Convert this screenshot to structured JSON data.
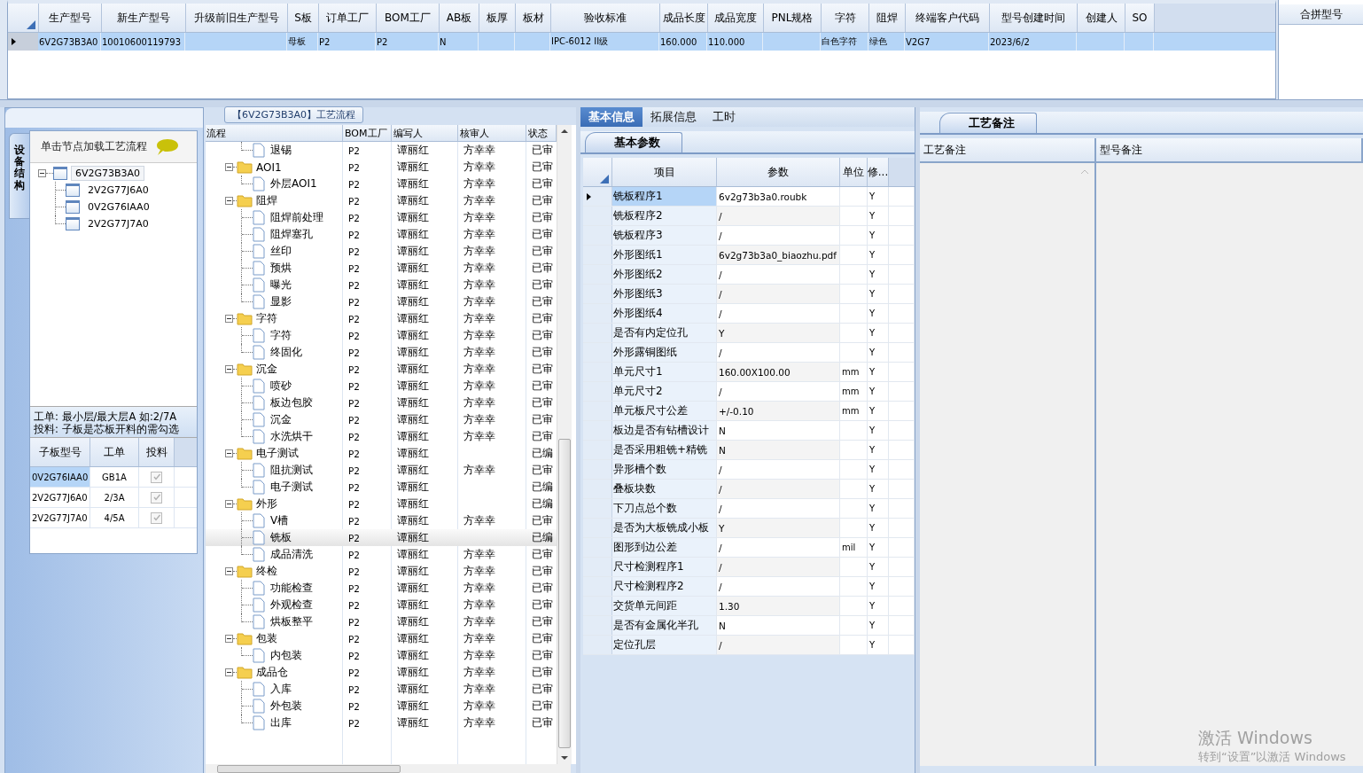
{
  "top_table": {
    "columns": [
      "生产型号",
      "新生产型号",
      "升级前旧生产型号",
      "S板",
      "订单工厂",
      "BOM工厂",
      "AB板",
      "板厚",
      "板材",
      "验收标准",
      "成品长度",
      "成品宽度",
      "PNL规格",
      "字符",
      "阻焊",
      "终端客户代码",
      "型号创建时间",
      "创建人",
      "SO"
    ],
    "rows": [
      {
        "selected": true,
        "cells": [
          "6V2G73B3A0",
          "10010600119793",
          null,
          "母板",
          "P2",
          "P2",
          "N",
          null,
          null,
          "IPC-6012 II级",
          "160.000",
          "110.000",
          null,
          "白色字符",
          "绿色",
          "V2G7",
          "2023/6/2",
          null,
          null
        ]
      }
    ]
  },
  "merge_panel": {
    "header": "合拼型号"
  },
  "structure_panel": {
    "side_tab": "设备结构",
    "hint": "单击节点加载工艺流程",
    "tree": [
      {
        "label": "6V2G73B3A0",
        "expanded": true,
        "selected": true,
        "children": [
          {
            "label": "2V2G77J6A0",
            "selected": false
          },
          {
            "label": "0V2G76IAA0",
            "selected": false
          },
          {
            "label": "2V2G77J7A0",
            "selected": false
          }
        ]
      }
    ],
    "note_lines": [
      "工单: 最小层/最大层A 如:2/7A",
      "投料: 子板是芯板开料的需勾选"
    ],
    "sub_boards": {
      "columns": [
        "子板型号",
        "工单",
        "投料"
      ],
      "rows": [
        {
          "model": "0V2G76IAA0",
          "order": "GB1A",
          "checked": true,
          "selected": true
        },
        {
          "model": "2V2G77J6A0",
          "order": "2/3A",
          "checked": true,
          "selected": false
        },
        {
          "model": "2V2G77J7A0",
          "order": "4/5A",
          "checked": true,
          "selected": false
        }
      ]
    }
  },
  "process_panel": {
    "title": "【6V2G73B3A0】工艺流程",
    "columns": [
      "流程",
      "BOM工厂",
      "编写人",
      "核审人",
      "状态"
    ],
    "rows": [
      {
        "kind": "step",
        "name": "退锡",
        "bom": "P2",
        "writer": "谭丽红",
        "reviewer": "方幸幸",
        "status": "已审",
        "selected": false
      },
      {
        "kind": "folder",
        "name": "AOI1",
        "bom": "P2",
        "writer": "谭丽红",
        "reviewer": "方幸幸",
        "status": "已审",
        "selected": false,
        "expanded": true,
        "children": [
          {
            "kind": "step",
            "name": "外层AOI1",
            "bom": "P2",
            "writer": "谭丽红",
            "reviewer": "方幸幸",
            "status": "已审",
            "selected": false
          }
        ]
      },
      {
        "kind": "folder",
        "name": "阻焊",
        "bom": "P2",
        "writer": "谭丽红",
        "reviewer": "方幸幸",
        "status": "已审",
        "selected": false,
        "expanded": true,
        "children": [
          {
            "kind": "step",
            "name": "阻焊前处理",
            "bom": "P2",
            "writer": "谭丽红",
            "reviewer": "方幸幸",
            "status": "已审",
            "selected": false
          },
          {
            "kind": "step",
            "name": "阻焊塞孔",
            "bom": "P2",
            "writer": "谭丽红",
            "reviewer": "方幸幸",
            "status": "已审",
            "selected": false
          },
          {
            "kind": "step",
            "name": "丝印",
            "bom": "P2",
            "writer": "谭丽红",
            "reviewer": "方幸幸",
            "status": "已审",
            "selected": false
          },
          {
            "kind": "step",
            "name": "预烘",
            "bom": "P2",
            "writer": "谭丽红",
            "reviewer": "方幸幸",
            "status": "已审",
            "selected": false
          },
          {
            "kind": "step",
            "name": "曝光",
            "bom": "P2",
            "writer": "谭丽红",
            "reviewer": "方幸幸",
            "status": "已审",
            "selected": false
          },
          {
            "kind": "step",
            "name": "显影",
            "bom": "P2",
            "writer": "谭丽红",
            "reviewer": "方幸幸",
            "status": "已审",
            "selected": false
          }
        ]
      },
      {
        "kind": "folder",
        "name": "字符",
        "bom": "P2",
        "writer": "谭丽红",
        "reviewer": "方幸幸",
        "status": "已审",
        "selected": false,
        "expanded": true,
        "children": [
          {
            "kind": "step",
            "name": "字符",
            "bom": "P2",
            "writer": "谭丽红",
            "reviewer": "方幸幸",
            "status": "已审",
            "selected": false
          },
          {
            "kind": "step",
            "name": "终固化",
            "bom": "P2",
            "writer": "谭丽红",
            "reviewer": "方幸幸",
            "status": "已审",
            "selected": false
          }
        ]
      },
      {
        "kind": "folder",
        "name": "沉金",
        "bom": "P2",
        "writer": "谭丽红",
        "reviewer": "方幸幸",
        "status": "已审",
        "selected": false,
        "expanded": true,
        "children": [
          {
            "kind": "step",
            "name": "喷砂",
            "bom": "P2",
            "writer": "谭丽红",
            "reviewer": "方幸幸",
            "status": "已审",
            "selected": false
          },
          {
            "kind": "step",
            "name": "板边包胶",
            "bom": "P2",
            "writer": "谭丽红",
            "reviewer": "方幸幸",
            "status": "已审",
            "selected": false
          },
          {
            "kind": "step",
            "name": "沉金",
            "bom": "P2",
            "writer": "谭丽红",
            "reviewer": "方幸幸",
            "status": "已审",
            "selected": false
          },
          {
            "kind": "step",
            "name": "水洗烘干",
            "bom": "P2",
            "writer": "谭丽红",
            "reviewer": "方幸幸",
            "status": "已审",
            "selected": false
          }
        ]
      },
      {
        "kind": "folder",
        "name": "电子测试",
        "bom": "P2",
        "writer": "谭丽红",
        "status": "已编",
        "selected": false,
        "expanded": true,
        "children": [
          {
            "kind": "step",
            "name": "阻抗测试",
            "bom": "P2",
            "writer": "谭丽红",
            "reviewer": "方幸幸",
            "status": "已审",
            "selected": false
          },
          {
            "kind": "step",
            "name": "电子测试",
            "bom": "P2",
            "writer": "谭丽红",
            "status": "已编",
            "selected": false
          }
        ]
      },
      {
        "kind": "folder",
        "name": "外形",
        "bom": "P2",
        "writer": "谭丽红",
        "status": "已编",
        "selected": false,
        "expanded": true,
        "children": [
          {
            "kind": "step",
            "name": "V槽",
            "bom": "P2",
            "writer": "谭丽红",
            "reviewer": "方幸幸",
            "status": "已审",
            "selected": false
          },
          {
            "kind": "step",
            "name": "铣板",
            "bom": "P2",
            "writer": "谭丽红",
            "status": "已编",
            "selected": true
          },
          {
            "kind": "step",
            "name": "成品清洗",
            "bom": "P2",
            "writer": "谭丽红",
            "reviewer": "方幸幸",
            "status": "已审",
            "selected": false
          }
        ]
      },
      {
        "kind": "folder",
        "name": "终检",
        "bom": "P2",
        "writer": "谭丽红",
        "reviewer": "方幸幸",
        "status": "已审",
        "selected": false,
        "expanded": true,
        "children": [
          {
            "kind": "step",
            "name": "功能检查",
            "bom": "P2",
            "writer": "谭丽红",
            "reviewer": "方幸幸",
            "status": "已审",
            "selected": false
          },
          {
            "kind": "step",
            "name": "外观检查",
            "bom": "P2",
            "writer": "谭丽红",
            "reviewer": "方幸幸",
            "status": "已审",
            "selected": false
          },
          {
            "kind": "step",
            "name": "烘板整平",
            "bom": "P2",
            "writer": "谭丽红",
            "reviewer": "方幸幸",
            "status": "已审",
            "selected": false
          }
        ]
      },
      {
        "kind": "folder",
        "name": "包装",
        "bom": "P2",
        "writer": "谭丽红",
        "reviewer": "方幸幸",
        "status": "已审",
        "selected": false,
        "expanded": true,
        "children": [
          {
            "kind": "step",
            "name": "内包装",
            "bom": "P2",
            "writer": "谭丽红",
            "reviewer": "方幸幸",
            "status": "已审",
            "selected": false
          }
        ]
      },
      {
        "kind": "folder",
        "name": "成品仓",
        "bom": "P2",
        "writer": "谭丽红",
        "reviewer": "方幸幸",
        "status": "已审",
        "selected": false,
        "expanded": true,
        "children": [
          {
            "kind": "step",
            "name": "入库",
            "bom": "P2",
            "writer": "谭丽红",
            "reviewer": "方幸幸",
            "status": "已审",
            "selected": false
          },
          {
            "kind": "step",
            "name": "外包装",
            "bom": "P2",
            "writer": "谭丽红",
            "reviewer": "方幸幸",
            "status": "已审",
            "selected": false
          },
          {
            "kind": "step",
            "name": "出库",
            "bom": "P2",
            "writer": "谭丽红",
            "reviewer": "方幸幸",
            "status": "已审",
            "selected": false
          }
        ]
      }
    ]
  },
  "detail_tabs": [
    {
      "label": "基本信息",
      "selected": true
    },
    {
      "label": "拓展信息",
      "selected": false
    },
    {
      "label": "工时",
      "selected": false
    }
  ],
  "params": {
    "tab": "基本参数",
    "columns": [
      "项目",
      "参数",
      "单位",
      "修..."
    ],
    "rows": [
      {
        "item": "铣板程序1",
        "value": "6v2g73b3a0.roubk",
        "flag": "Y",
        "selected": true
      },
      {
        "item": "铣板程序2",
        "value": "/",
        "flag": "Y",
        "selected": false
      },
      {
        "item": "铣板程序3",
        "value": "/",
        "flag": "Y",
        "selected": false
      },
      {
        "item": "外形图纸1",
        "value": "6v2g73b3a0_biaozhu.pdf",
        "flag": "Y",
        "selected": false
      },
      {
        "item": "外形图纸2",
        "value": "/",
        "flag": "Y",
        "selected": false
      },
      {
        "item": "外形图纸3",
        "value": "/",
        "flag": "Y",
        "selected": false
      },
      {
        "item": "外形图纸4",
        "value": "/",
        "flag": "Y",
        "selected": false
      },
      {
        "item": "是否有内定位孔",
        "value": "Y",
        "flag": "Y",
        "selected": false
      },
      {
        "item": "外形露铜图纸",
        "value": "/",
        "flag": "Y",
        "selected": false
      },
      {
        "item": "单元尺寸1",
        "value": "160.00X100.00",
        "unit": "mm",
        "flag": "Y",
        "selected": false
      },
      {
        "item": "单元尺寸2",
        "value": "/",
        "unit": "mm",
        "flag": "Y",
        "selected": false
      },
      {
        "item": "单元板尺寸公差",
        "value": "+/-0.10",
        "unit": "mm",
        "flag": "Y",
        "selected": false
      },
      {
        "item": "板边是否有钻槽设计",
        "value": "N",
        "flag": "Y",
        "selected": false
      },
      {
        "item": "是否采用粗铣+精铣",
        "value": "N",
        "flag": "Y",
        "selected": false
      },
      {
        "item": "异形槽个数",
        "value": "/",
        "flag": "Y",
        "selected": false
      },
      {
        "item": "叠板块数",
        "value": "/",
        "flag": "Y",
        "selected": false
      },
      {
        "item": "下刀点总个数",
        "value": "/",
        "flag": "Y",
        "selected": false
      },
      {
        "item": "是否为大板铣成小板",
        "value": "Y",
        "flag": "Y",
        "selected": false
      },
      {
        "item": "图形到边公差",
        "value": "/",
        "unit": "mil",
        "flag": "Y",
        "selected": false
      },
      {
        "item": "尺寸检测程序1",
        "value": "/",
        "flag": "Y",
        "selected": false
      },
      {
        "item": "尺寸检测程序2",
        "value": "/",
        "flag": "Y",
        "selected": false
      },
      {
        "item": "交货单元间距",
        "value": "1.30",
        "flag": "Y",
        "selected": false
      },
      {
        "item": "是否有金属化半孔",
        "value": "N",
        "flag": "Y",
        "selected": false
      },
      {
        "item": "定位孔层",
        "value": "/",
        "flag": "Y",
        "selected": false
      }
    ]
  },
  "remarks": {
    "tab": "工艺备注",
    "columns": [
      "工艺备注",
      "型号备注"
    ]
  },
  "os_notice": {
    "title": "激活 Windows",
    "text": "转到“设置”以激活 Windows"
  }
}
